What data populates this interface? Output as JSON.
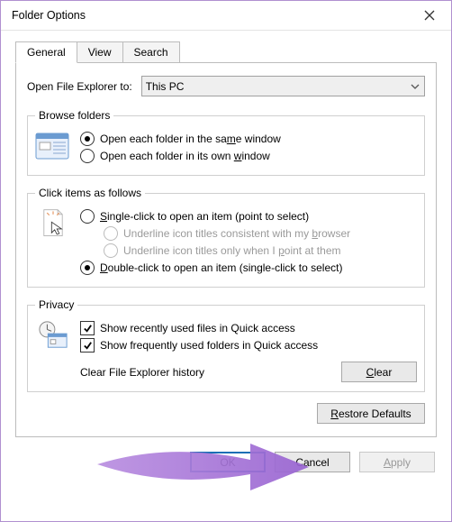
{
  "window": {
    "title": "Folder Options"
  },
  "tabs": {
    "general": "General",
    "view": "View",
    "search": "Search"
  },
  "openExplorer": {
    "label": "Open File Explorer to:",
    "value": "This PC"
  },
  "browseFolders": {
    "legend": "Browse folders",
    "sameWindow_pre": "Open each folder in the sa",
    "sameWindow_u": "m",
    "sameWindow_post": "e window",
    "ownWindow_pre": "Open each folder in its own ",
    "ownWindow_u": "w",
    "ownWindow_post": "indow"
  },
  "clickItems": {
    "legend": "Click items as follows",
    "single_u": "S",
    "single_post": "ingle-click to open an item (point to select)",
    "sub1_pre": "Underline icon titles consistent with my ",
    "sub1_u": "b",
    "sub1_post": "rowser",
    "sub2_pre": "Underline icon titles only when I ",
    "sub2_u": "p",
    "sub2_post": "oint at them",
    "double_u": "D",
    "double_post": "ouble-click to open an item (single-click to select)"
  },
  "privacy": {
    "legend": "Privacy",
    "recent": "Show recently used files in Quick access",
    "frequent": "Show frequently used folders in Quick access",
    "clearHistory": "Clear File Explorer history",
    "clear_u": "C",
    "clear_post": "lear"
  },
  "restore": {
    "u": "R",
    "post": "estore Defaults"
  },
  "buttons": {
    "ok": "OK",
    "cancel": "Cancel",
    "apply_u": "A",
    "apply_post": "pply"
  }
}
